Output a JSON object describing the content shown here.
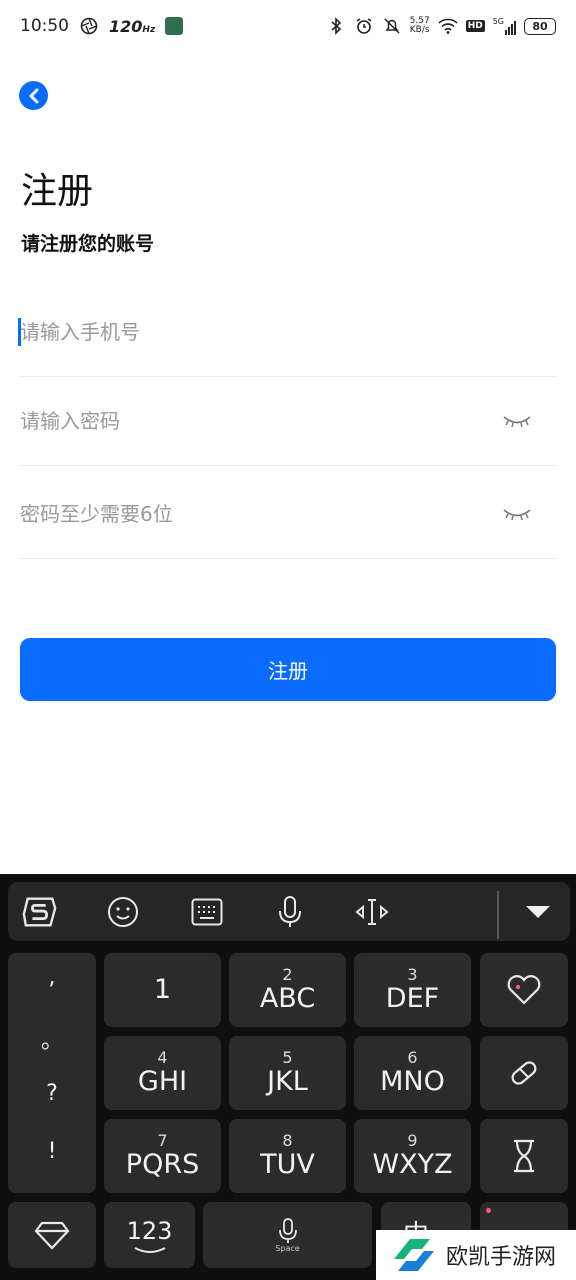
{
  "status_bar": {
    "time": "10:50",
    "refresh_rate": "120",
    "refresh_unit": "Hz",
    "net_speed_value": "5.57",
    "net_speed_unit": "KB/s",
    "hd_badge": "HD",
    "network": "5G",
    "battery": "80"
  },
  "header": {
    "title": "注册",
    "subtitle": "请注册您的账号"
  },
  "form": {
    "phone_placeholder": "请输入手机号",
    "password_placeholder": "请输入密码",
    "confirm_placeholder": "密码至少需要6位"
  },
  "register_button": {
    "label": "注册"
  },
  "keyboard": {
    "punctuation": [
      ",",
      "。",
      "?",
      "!"
    ],
    "keys": [
      {
        "sub": "",
        "main": "1"
      },
      {
        "sub": "2",
        "main": "ABC"
      },
      {
        "sub": "3",
        "main": "DEF"
      },
      {
        "sub": "4",
        "main": "GHI"
      },
      {
        "sub": "5",
        "main": "JKL"
      },
      {
        "sub": "6",
        "main": "MNO"
      },
      {
        "sub": "7",
        "main": "PQRS"
      },
      {
        "sub": "8",
        "main": "TUV"
      },
      {
        "sub": "9",
        "main": "WXYZ"
      }
    ],
    "num_key": "123",
    "space_label": "Space",
    "lang_key": "中"
  },
  "watermark": {
    "text": "欧凯手游网"
  },
  "colors": {
    "accent": "#0a6cff",
    "keyboard_bg": "#0f0f0f",
    "key_bg": "#2b2b2b"
  }
}
